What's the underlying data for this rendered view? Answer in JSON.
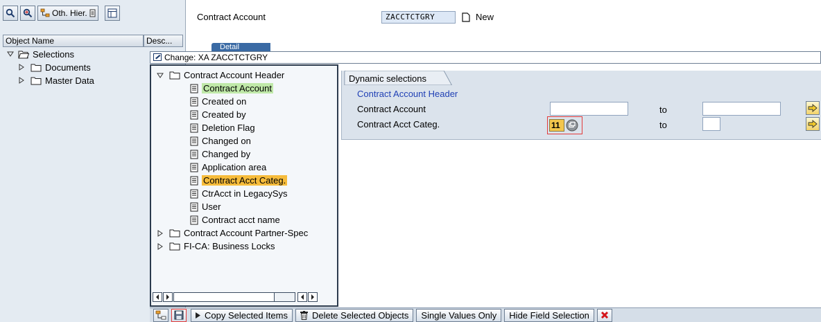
{
  "left_toolbar": {
    "other_hierarchy_label": "Oth. Hier."
  },
  "left_columns": {
    "object_name": "Object Name",
    "description": "Desc..."
  },
  "left_tree": [
    {
      "label": "Selections",
      "state": "expanded"
    },
    {
      "label": "Documents",
      "state": "collapsed"
    },
    {
      "label": "Master Data",
      "state": "collapsed"
    }
  ],
  "header": {
    "field_label": "Contract Account",
    "field_value": "ZACCTCTGRY",
    "new_label": "New",
    "detail_tab": "Detail"
  },
  "change_bar": {
    "title": "Change: XA ZACCTCTGRY"
  },
  "mid_tree": {
    "root": "Contract Account Header",
    "items": [
      {
        "label": "Contract Account",
        "highlight": "green"
      },
      {
        "label": "Created on"
      },
      {
        "label": "Created by"
      },
      {
        "label": "Deletion Flag"
      },
      {
        "label": "Changed on"
      },
      {
        "label": "Changed by"
      },
      {
        "label": "Application area"
      },
      {
        "label": "Contract Acct Categ.",
        "highlight": "yellow"
      },
      {
        "label": "CtrAcct in LegacySys"
      },
      {
        "label": "User"
      },
      {
        "label": "Contract acct name"
      }
    ],
    "other_folders": [
      "Contract Account Partner-Spec",
      "FI-CA: Business Locks"
    ]
  },
  "dynamic": {
    "tab_title": "Dynamic selections",
    "header": "Contract Account Header",
    "rows": [
      {
        "label": "Contract Account",
        "from": "",
        "to_label": "to",
        "to": ""
      },
      {
        "label": "Contract Acct Categ.",
        "from": "11",
        "to_label": "to",
        "to": ""
      }
    ]
  },
  "bottom_toolbar": {
    "copy": "Copy Selected Items",
    "delete": "Delete Selected Objects",
    "single": "Single Values Only",
    "hide": "Hide Field Selection"
  },
  "colors": {
    "highlight_green": "#bfe8a8",
    "highlight_yellow": "#f6bc3b",
    "header_blue": "#1f3fb4",
    "panel_bg": "#dbe3ec"
  }
}
